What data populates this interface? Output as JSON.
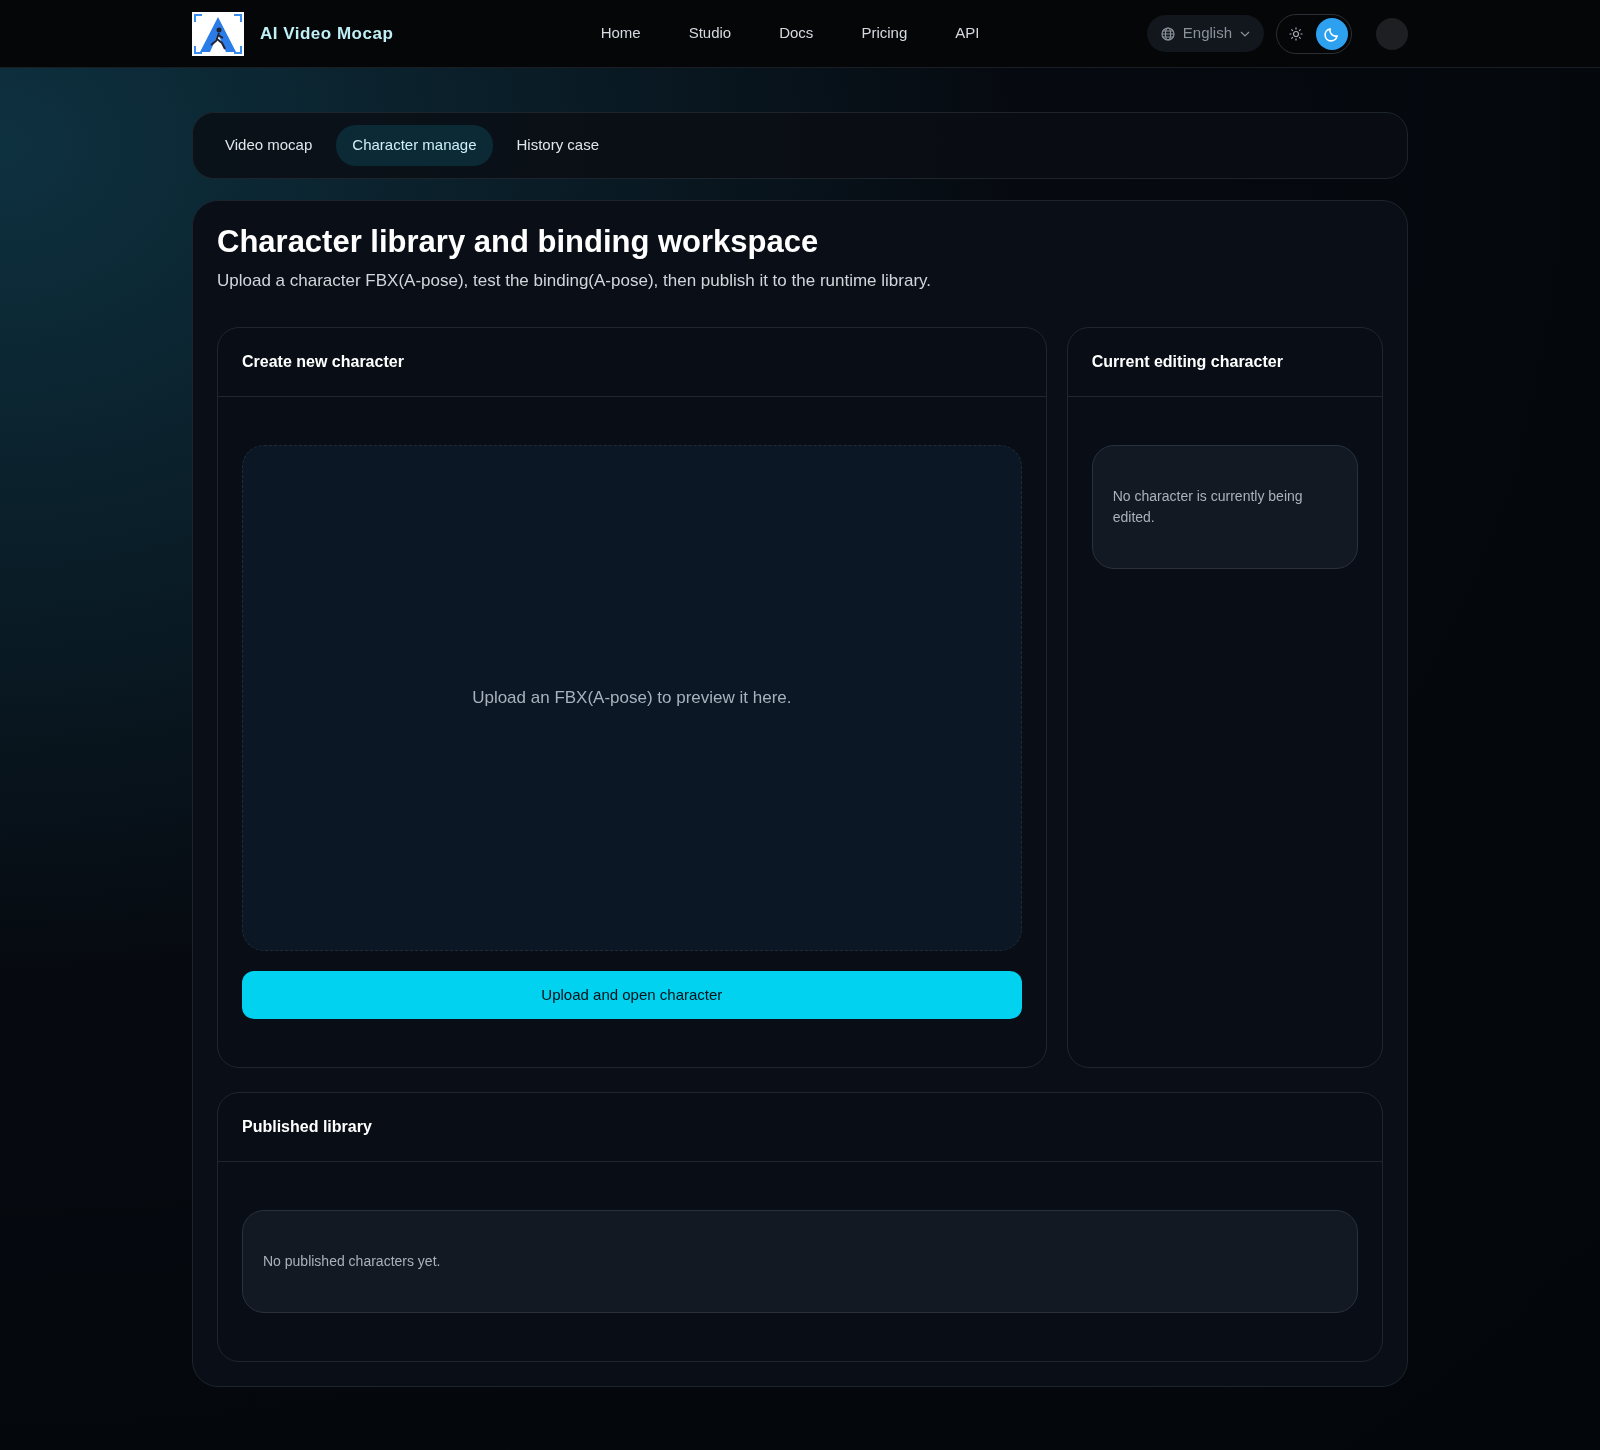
{
  "navbar": {
    "brand": "AI Video Mocap",
    "links": [
      "Home",
      "Studio",
      "Docs",
      "Pricing",
      "API"
    ],
    "language": "English",
    "theme": [
      {
        "kind": "light",
        "selected": false
      },
      {
        "kind": "dark",
        "selected": true
      }
    ]
  },
  "tabs": [
    {
      "label": "Video mocap",
      "selected": false
    },
    {
      "label": "Character manage",
      "selected": true
    },
    {
      "label": "History case",
      "selected": false
    }
  ],
  "workspace": {
    "title": "Character library and binding workspace",
    "subtitle": "Upload a character FBX(A-pose), test the binding(A-pose), then publish it to the runtime library.",
    "create": {
      "title": "Create new character",
      "preview_text": "Upload an FBX(A-pose) to preview it here.",
      "button": "Upload and open character"
    },
    "current": {
      "title": "Current editing character",
      "empty_text": "No character is currently being edited."
    },
    "published": {
      "title": "Published library",
      "empty_text": "No published characters yet."
    }
  }
}
